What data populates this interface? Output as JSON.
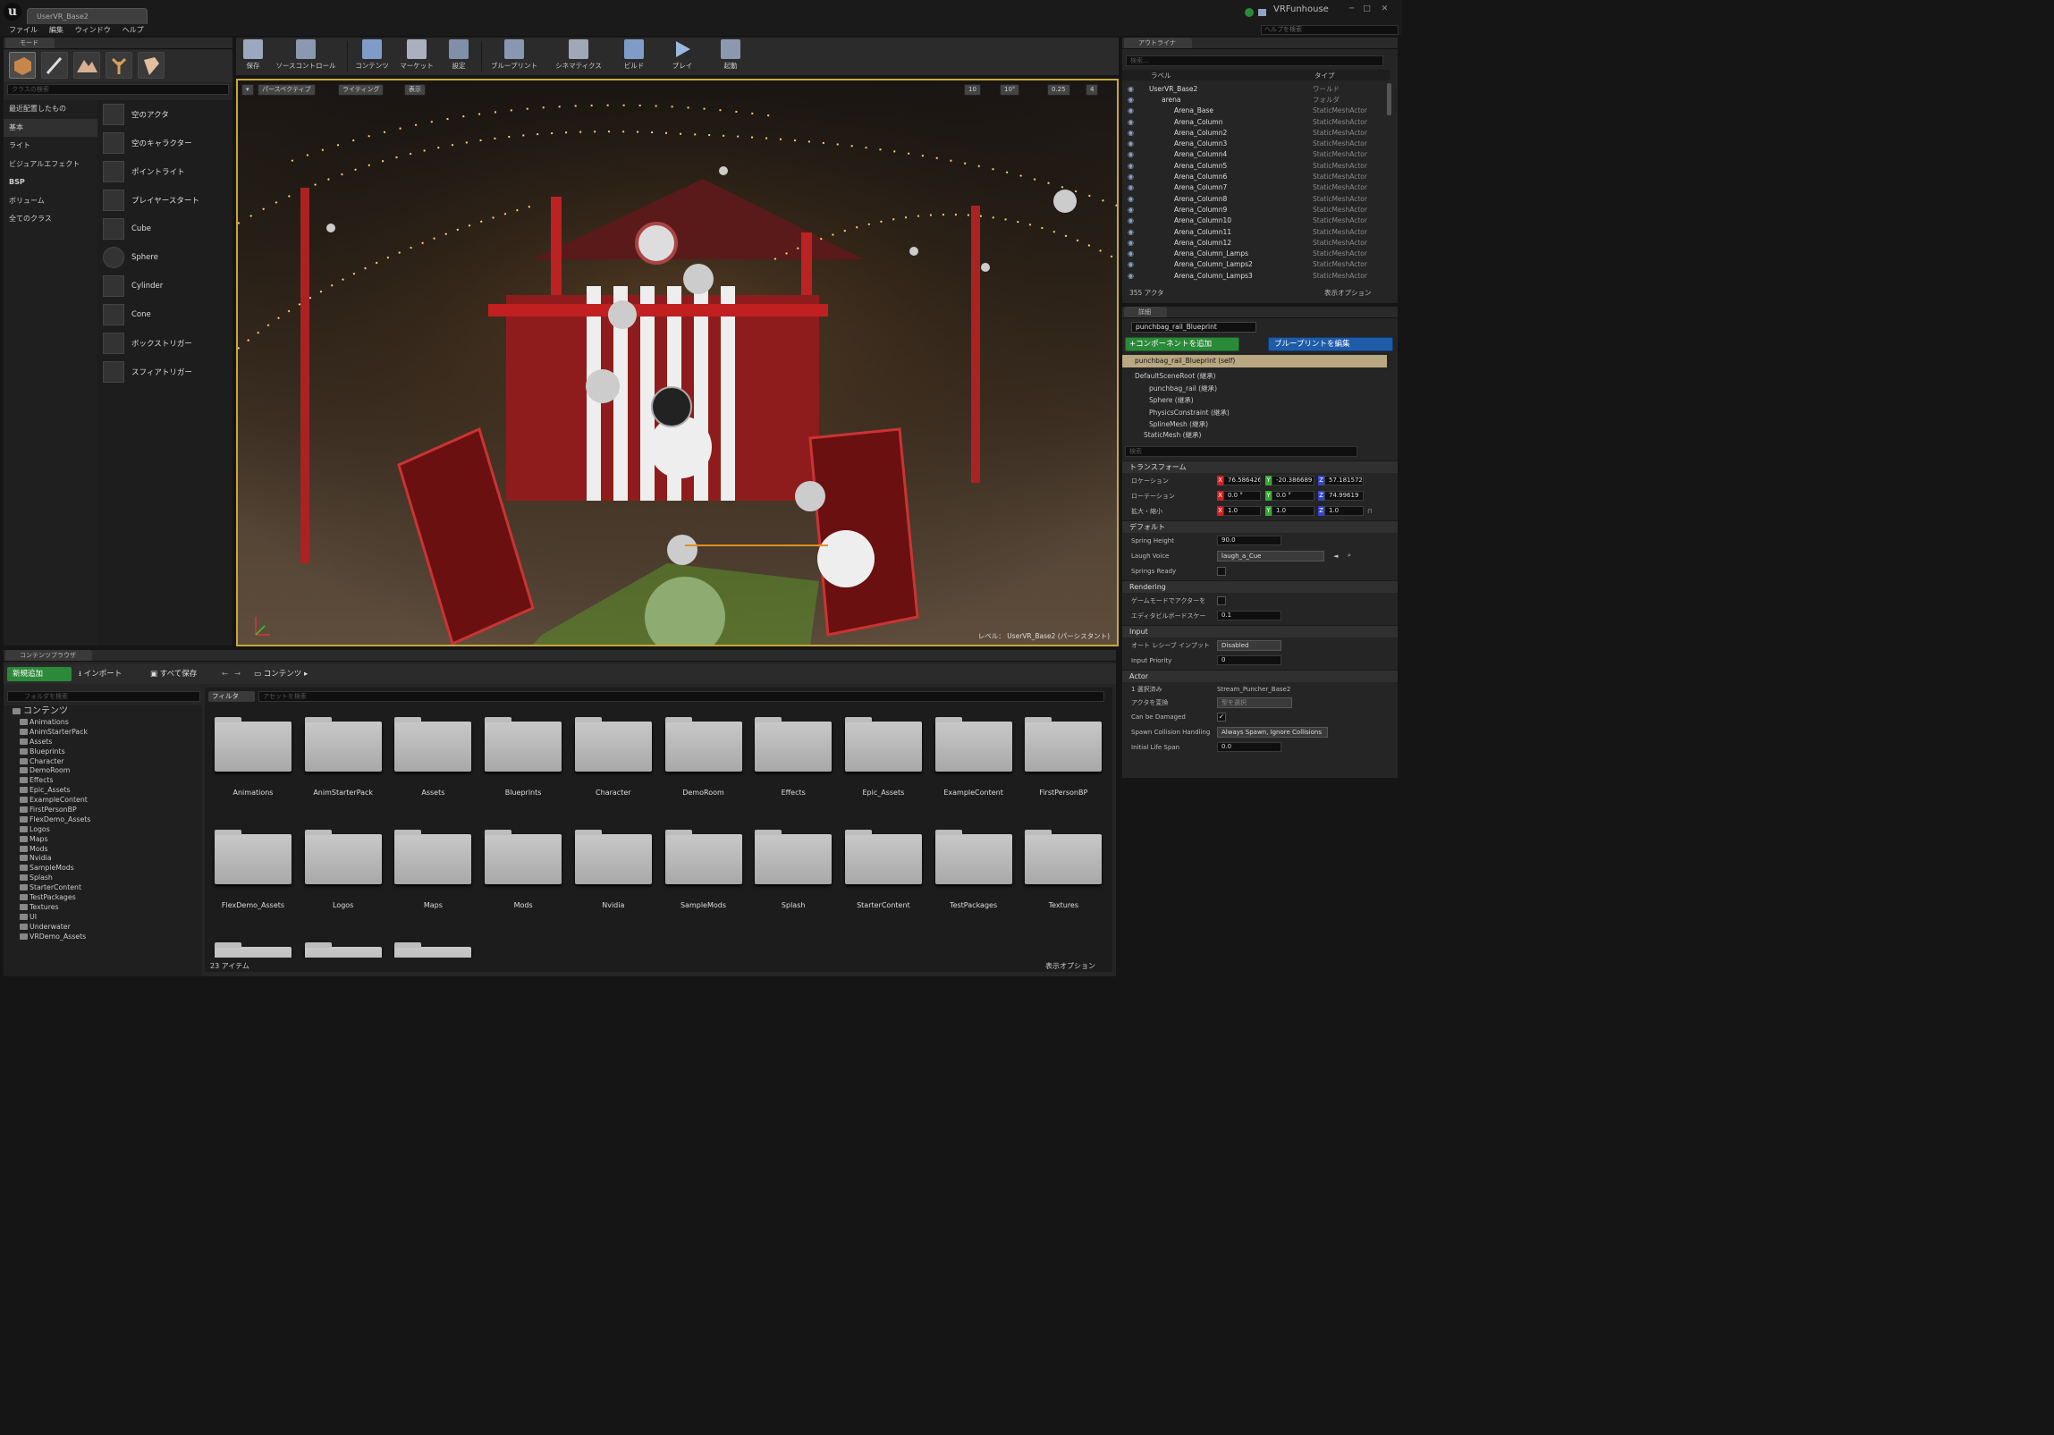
{
  "window": {
    "tab_title": "UserVR_Base2",
    "project_name": "VRFunhouse",
    "help_search_placeholder": "ヘルプを検索",
    "minimize": "─",
    "maximize": "□",
    "close": "✕"
  },
  "menu": [
    "ファイル",
    "編集",
    "ウィンドウ",
    "ヘルプ"
  ],
  "modes_panel": {
    "tab": "モード",
    "search_placeholder": "クラスの検索",
    "categories": [
      "最近配置したもの",
      "基本",
      "ライト",
      "ビジュアルエフェクト",
      "BSP",
      "ボリューム",
      "全てのクラス"
    ],
    "selected_category": "基本",
    "items": [
      "空のアクタ",
      "空のキャラクター",
      "ポイントライト",
      "プレイヤースタート",
      "Cube",
      "Sphere",
      "Cylinder",
      "Cone",
      "ボックストリガー",
      "スフィアトリガー"
    ]
  },
  "toolbar": {
    "buttons": [
      "保存",
      "ソースコントロール",
      "コンテンツ",
      "マーケット",
      "設定",
      "ブループリント",
      "シネマティクス",
      "ビルド",
      "プレイ",
      "起動"
    ]
  },
  "viewport": {
    "perspective": "パースペクティブ",
    "lighting": "ライティング",
    "show": "表示",
    "grid_snap": "10",
    "rot_snap": "10°",
    "scale_snap": "0.25",
    "camera_speed": "4",
    "level_label": "レベル：",
    "level_name": "UserVR_Base2 (パーシスタント)"
  },
  "outliner": {
    "tab": "アウトライナ",
    "search_placeholder": "検索...",
    "col_label": "ラベル",
    "col_type": "タイプ",
    "rows": [
      {
        "label": "UserVR_Base2",
        "type": "ワールド",
        "indent": 0
      },
      {
        "label": "arena",
        "type": "フォルダ",
        "indent": 1
      },
      {
        "label": "Arena_Base",
        "type": "StaticMeshActor",
        "indent": 2
      },
      {
        "label": "Arena_Column",
        "type": "StaticMeshActor",
        "indent": 2
      },
      {
        "label": "Arena_Column2",
        "type": "StaticMeshActor",
        "indent": 2
      },
      {
        "label": "Arena_Column3",
        "type": "StaticMeshActor",
        "indent": 2
      },
      {
        "label": "Arena_Column4",
        "type": "StaticMeshActor",
        "indent": 2
      },
      {
        "label": "Arena_Column5",
        "type": "StaticMeshActor",
        "indent": 2
      },
      {
        "label": "Arena_Column6",
        "type": "StaticMeshActor",
        "indent": 2
      },
      {
        "label": "Arena_Column7",
        "type": "StaticMeshActor",
        "indent": 2
      },
      {
        "label": "Arena_Column8",
        "type": "StaticMeshActor",
        "indent": 2
      },
      {
        "label": "Arena_Column9",
        "type": "StaticMeshActor",
        "indent": 2
      },
      {
        "label": "Arena_Column10",
        "type": "StaticMeshActor",
        "indent": 2
      },
      {
        "label": "Arena_Column11",
        "type": "StaticMeshActor",
        "indent": 2
      },
      {
        "label": "Arena_Column12",
        "type": "StaticMeshActor",
        "indent": 2
      },
      {
        "label": "Arena_Column_Lamps",
        "type": "StaticMeshActor",
        "indent": 2
      },
      {
        "label": "Arena_Column_Lamps2",
        "type": "StaticMeshActor",
        "indent": 2
      },
      {
        "label": "Arena_Column_Lamps3",
        "type": "StaticMeshActor",
        "indent": 2
      }
    ],
    "actor_count": "355 アクタ",
    "view_options": "表示オプション"
  },
  "details": {
    "tab": "詳細",
    "actor_name": "punchbag_rail_Blueprint",
    "add_component": "+コンポーネントを追加",
    "edit_blueprint": "ブループリントを編集",
    "self_row": "punchbag_rail_Blueprint (self)",
    "components": [
      "DefaultSceneRoot (継承)",
      "punchbag_rail (継承)",
      "Sphere (継承)",
      "PhysicsConstraint (継承)",
      "SplineMesh (継承)",
      "StaticMesh (継承)"
    ],
    "search_placeholder": "検索",
    "transform": {
      "header": "トランスフォーム",
      "location_label": "ロケーション",
      "rotation_label": "ローテーション",
      "scale_label": "拡大・縮小",
      "location": [
        "76.586426",
        "-20.386689",
        "57.181572"
      ],
      "rotation": [
        "0.0 °",
        "0.0 °",
        "74.99619"
      ],
      "scale": [
        "1.0",
        "1.0",
        "1.0"
      ]
    },
    "default": {
      "header": "デフォルト",
      "spring_height_label": "Spring Height",
      "spring_height": "90.0",
      "laugh_voice_label": "Laugh Voice",
      "laugh_voice": "laugh_a_Cue",
      "springs_ready_label": "Springs Ready"
    },
    "rendering": {
      "header": "Rendering",
      "hidden_in_game_label": "ゲームモードでアクターを",
      "editor_billboard_label": "エディタビルボードスケー",
      "editor_billboard": "0.1"
    },
    "input": {
      "header": "Input",
      "auto_receive_label": "オート レシーブ インプット",
      "auto_receive": "Disabled",
      "priority_label": "Input Priority",
      "priority": "0"
    },
    "actor": {
      "header": "Actor",
      "selected_label": "1 選択済み",
      "selected_value": "Stream_Puncher_Base2",
      "convert_label": "アクタを変換",
      "convert_value": "型を選択",
      "can_damage_label": "Can be Damaged",
      "spawn_label": "Spawn Collision Handling M",
      "spawn_value": "Always Spawn, Ignore Collisions",
      "life_label": "Initial Life Span",
      "life_value": "0.0"
    }
  },
  "content_browser": {
    "tab": "コンテンツブラウザ",
    "add_new": "新規追加",
    "import": "インポート",
    "save_all": "すべて保存",
    "path": "コンテンツ",
    "folder_search_placeholder": "フォルダを検索",
    "filter": "フィルタ",
    "asset_search_placeholder": "アセットを検索",
    "tree_root": "コンテンツ",
    "tree": [
      "Animations",
      "AnimStarterPack",
      "Assets",
      "Blueprints",
      "Character",
      "DemoRoom",
      "Effects",
      "Epic_Assets",
      "ExampleContent",
      "FirstPersonBP",
      "FlexDemo_Assets",
      "Logos",
      "Maps",
      "Mods",
      "Nvidia",
      "SampleMods",
      "Splash",
      "StarterContent",
      "TestPackages",
      "Textures",
      "UI",
      "Underwater",
      "VRDemo_Assets"
    ],
    "folders": [
      "Animations",
      "AnimStarterPack",
      "Assets",
      "Blueprints",
      "Character",
      "DemoRoom",
      "Effects",
      "Epic_Assets",
      "ExampleContent",
      "FirstPersonBP",
      "FlexDemo_Assets",
      "Logos",
      "Maps",
      "Mods",
      "Nvidia",
      "SampleMods",
      "Splash",
      "StarterContent",
      "TestPackages",
      "Textures"
    ],
    "item_count": "23 アイテム",
    "view_options": "表示オプション"
  },
  "colors": {
    "accent_green": "#2a8a3a",
    "accent_blue": "#1f5ca8",
    "viewport_border": "#c7a93a",
    "selection": "#b9a882"
  }
}
